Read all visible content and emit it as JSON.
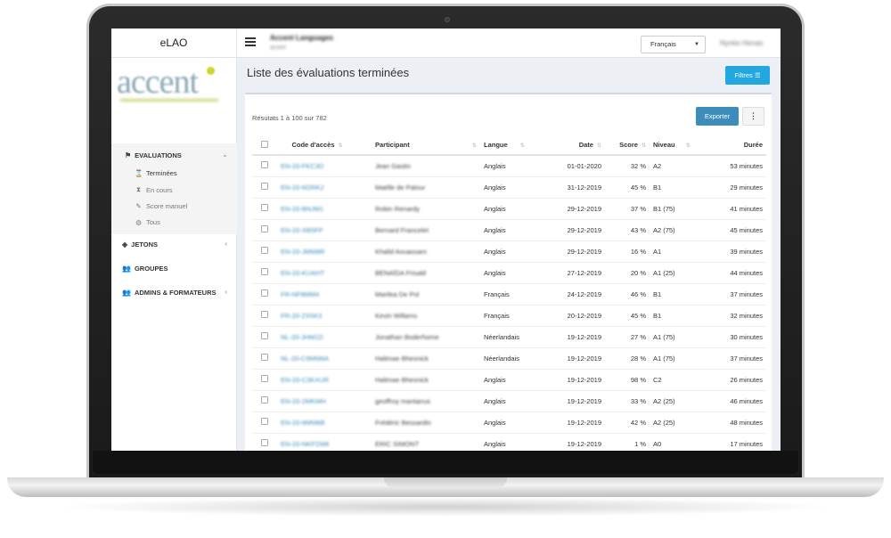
{
  "app": {
    "brand": "eLAO",
    "org_name": "Accent Languages",
    "org_sub": "accent",
    "user_name": "Nynke Henao"
  },
  "language_select": {
    "value": "Français"
  },
  "logo": {
    "text": "accent"
  },
  "sidebar": {
    "evaluations_label": "EVALUATIONS",
    "sub_items": [
      {
        "label": "Terminées",
        "icon": "hourglass-icon"
      },
      {
        "label": "En cours",
        "icon": "hourglass-empty-icon"
      },
      {
        "label": "Score manuel",
        "icon": "edit-icon"
      },
      {
        "label": "Tous",
        "icon": "globe-icon"
      }
    ],
    "jetons_label": "JETONS",
    "groupes_label": "GROUPES",
    "admins_label": "ADMINS & FORMATEURS"
  },
  "page": {
    "title": "Liste des évaluations terminées",
    "filters_label": "Filtres",
    "results_text": "Résutats 1 à 100 sur 782",
    "export_label": "Exporter",
    "more_label": "⋮"
  },
  "table": {
    "headers": [
      "Code d'accès",
      "Participant",
      "Langue",
      "Date",
      "Score",
      "Niveau",
      "Durée"
    ],
    "rows": [
      [
        "EN-20-FKC3D",
        "Jean Gastin",
        "Anglais",
        "01-01-2020",
        "32 %",
        "A2",
        "53 minutes"
      ],
      [
        "EN-20-M2RK2",
        "Maëlle de Palour",
        "Anglais",
        "31-12-2019",
        "45 %",
        "B1",
        "29 minutes"
      ],
      [
        "EN-20-BNJM1",
        "Robin Renardy",
        "Anglais",
        "29-12-2019",
        "37 %",
        "B1 (75)",
        "41 minutes"
      ],
      [
        "EN-20-XB5FP",
        "Bernard Francelet",
        "Anglais",
        "29-12-2019",
        "43 %",
        "A2 (75)",
        "45 minutes"
      ],
      [
        "EN-20-JMM8R",
        "Khalid Aouassam",
        "Anglais",
        "29-12-2019",
        "16 %",
        "A1",
        "39 minutes"
      ],
      [
        "EN-20-KUAHT",
        "BENAÏDA Frisald",
        "Anglais",
        "27-12-2019",
        "20 %",
        "A1 (25)",
        "44 minutes"
      ],
      [
        "FR-NF8MM4",
        "Marilea De Pol",
        "Français",
        "24-12-2019",
        "46 %",
        "B1",
        "37 minutes"
      ],
      [
        "FR-20-ZX5K3",
        "Kevin Willams",
        "Français",
        "20-12-2019",
        "45 %",
        "B1",
        "32 minutes"
      ],
      [
        "NL-20-JHM1D",
        "Jonathan Boderhome",
        "Néerlandais",
        "19-12-2019",
        "27 %",
        "A1 (75)",
        "30 minutes"
      ],
      [
        "NL-20-C9MM6A",
        "Halimae Bhesnick",
        "Néerlandais",
        "19-12-2019",
        "28 %",
        "A1 (75)",
        "37 minutes"
      ],
      [
        "EN-20-C3KXUR",
        "Halimae Bhesnick",
        "Anglais",
        "19-12-2019",
        "98 %",
        "C2",
        "26 minutes"
      ],
      [
        "EN-20-2MKMH",
        "geoffroy mantanus",
        "Anglais",
        "19-12-2019",
        "33 %",
        "A2 (25)",
        "46 minutes"
      ],
      [
        "EN-20-9MM8B",
        "Frédéric Bessardin",
        "Anglais",
        "19-12-2019",
        "42 %",
        "A2 (25)",
        "48 minutes"
      ],
      [
        "EN-20-NKPZM8",
        "ERIC SIMONT",
        "Anglais",
        "19-12-2019",
        "1 %",
        "A0",
        "17 minutes"
      ]
    ]
  }
}
